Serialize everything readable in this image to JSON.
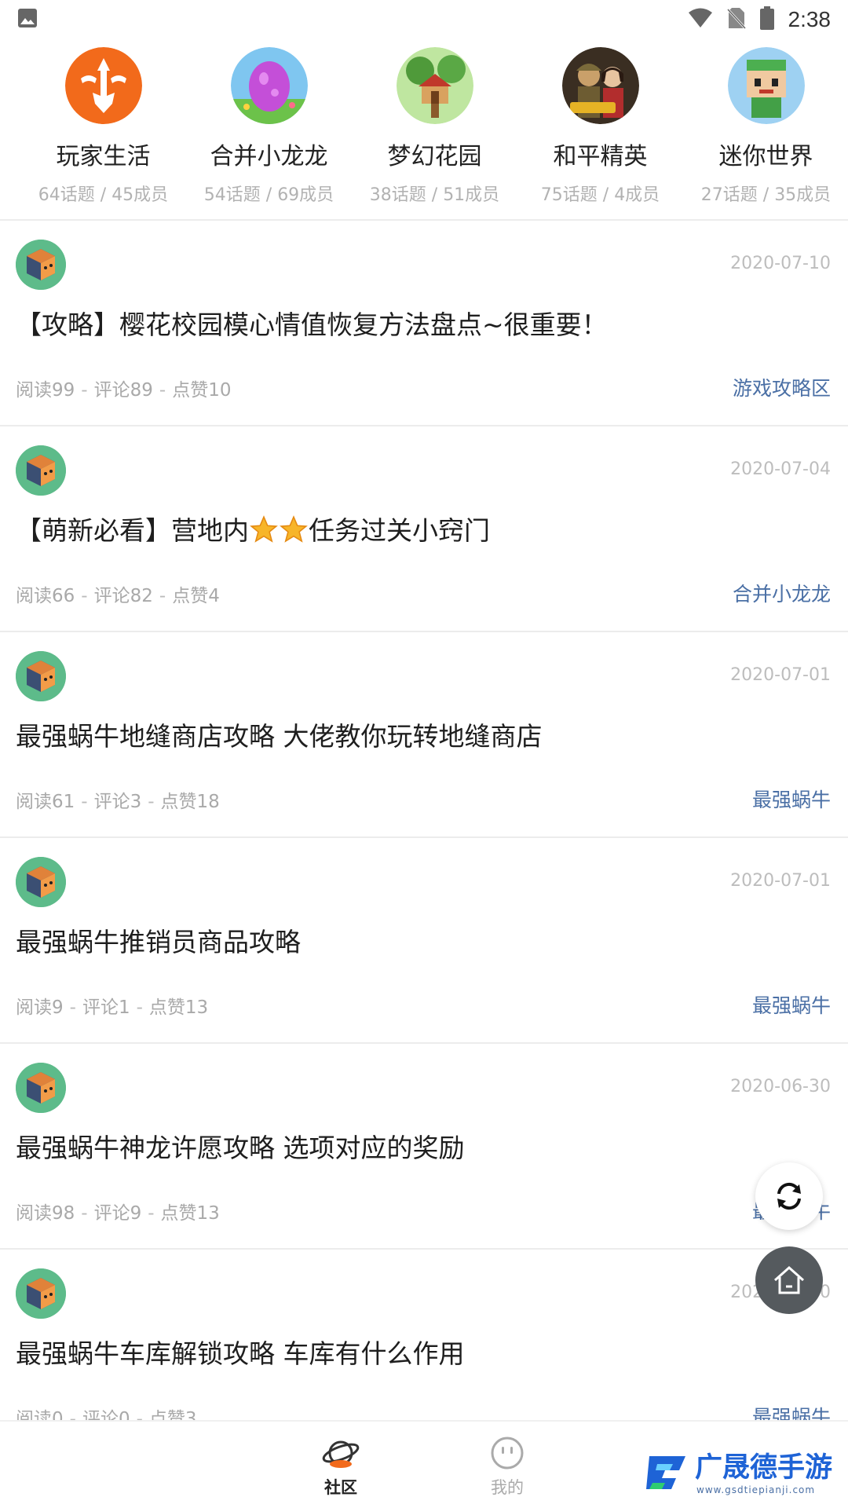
{
  "status_bar": {
    "time": "2:38",
    "icons": [
      "image-icon",
      "wifi-icon",
      "no-sim-icon",
      "battery-icon"
    ]
  },
  "circles": [
    {
      "name": "玩家生活",
      "stats": "64话题 / 45成员",
      "icon": "sword-shield-icon"
    },
    {
      "name": "合并小龙龙",
      "stats": "54话题 / 69成员",
      "icon": "dragon-egg-icon"
    },
    {
      "name": "梦幻花园",
      "stats": "38话题 / 51成员",
      "icon": "treehouse-icon"
    },
    {
      "name": "和平精英",
      "stats": "75话题 / 4成员",
      "icon": "soldiers-icon"
    },
    {
      "name": "迷你世界",
      "stats": "27话题 / 35成员",
      "icon": "block-character-icon"
    }
  ],
  "posts": [
    {
      "date": "2020-07-10",
      "title": "【攻略】樱花校园模心情值恢复方法盘点~很重要！",
      "reads": "阅读99",
      "comments": "评论89",
      "likes": "点赞10",
      "category": "游戏攻略区"
    },
    {
      "date": "2020-07-04",
      "title_before": "【萌新必看】营地内",
      "title_after": "任务过关小窍门",
      "reads": "阅读66",
      "comments": "评论82",
      "likes": "点赞4",
      "category": "合并小龙龙"
    },
    {
      "date": "2020-07-01",
      "title": "最强蜗牛地缝商店攻略 大佬教你玩转地缝商店",
      "reads": "阅读61",
      "comments": "评论3",
      "likes": "点赞18",
      "category": "最强蜗牛"
    },
    {
      "date": "2020-07-01",
      "title": "最强蜗牛推销员商品攻略",
      "reads": "阅读9",
      "comments": "评论1",
      "likes": "点赞13",
      "category": "最强蜗牛"
    },
    {
      "date": "2020-06-30",
      "title": "最强蜗牛神龙许愿攻略 选项对应的奖励",
      "reads": "阅读98",
      "comments": "评论9",
      "likes": "点赞13",
      "category": "最强蜗牛"
    },
    {
      "date": "2020-06-30",
      "title": "最强蜗牛车库解锁攻略 车库有什么作用",
      "reads": "阅读0",
      "comments": "评论0",
      "likes": "点赞3",
      "category": "最强蜗牛"
    }
  ],
  "meta_separator": "-",
  "bottom_nav": {
    "community_label": "社区",
    "mine_label": "我的"
  },
  "watermark": {
    "text": "广晟德手游",
    "url": "www.gsdtiepianji.com"
  },
  "colors": {
    "category_link": "#4a6fa5",
    "muted_text": "#a9a9a9",
    "avatar_bg": "#5dbb8a",
    "accent_orange": "#f26a1b"
  }
}
